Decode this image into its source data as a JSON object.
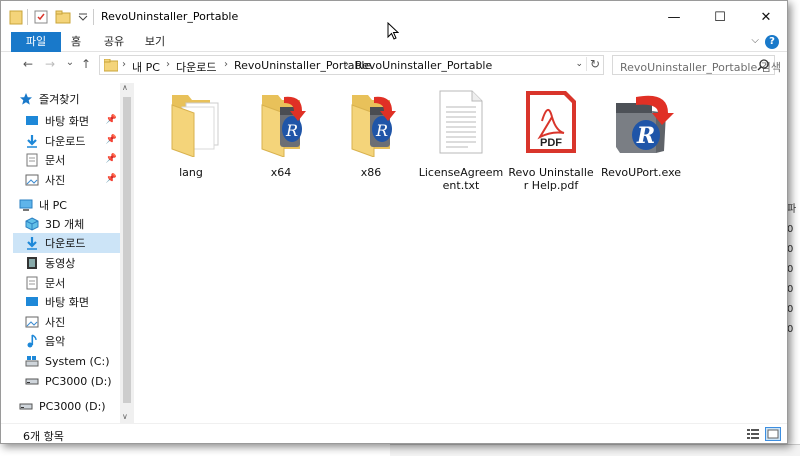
{
  "window": {
    "title": "RevoUninstaller_Portable",
    "controls": {
      "minimize": "—",
      "maximize": "☐",
      "close": "✕"
    }
  },
  "ribbon": {
    "tabs": [
      "파일",
      "홈",
      "공유",
      "보기"
    ],
    "help": "?",
    "collapse": "⌵"
  },
  "nav": {
    "back": "←",
    "forward": "→",
    "recent": "⌄",
    "up": "↑"
  },
  "address": {
    "crumbs": [
      "내 PC",
      "다운로드",
      "RevoUninstaller_Portable",
      "RevoUninstaller_Portable"
    ],
    "separator": "›",
    "dropdown": "⌄",
    "refresh": "↻"
  },
  "search": {
    "placeholder": "RevoUninstaller_Portable 검색"
  },
  "sidebar": {
    "quick_access": "즐겨찾기",
    "quick_items": [
      "바탕 화면",
      "다운로드",
      "문서",
      "사진"
    ],
    "this_pc": "내 PC",
    "pc_items": [
      "3D 개체",
      "다운로드",
      "동영상",
      "문서",
      "바탕 화면",
      "사진",
      "음악",
      "System (C:)",
      "PC3000 (D:)"
    ],
    "drive": "PC3000 (D:)",
    "pin": "📌",
    "scroll_up": "∧",
    "scroll_down": "∨"
  },
  "files": [
    {
      "name": "lang",
      "kind": "folder"
    },
    {
      "name": "x64",
      "kind": "folder-revo"
    },
    {
      "name": "x86",
      "kind": "folder-revo"
    },
    {
      "name": "LicenseAgreement.txt",
      "kind": "text"
    },
    {
      "name": "Revo Uninstaller Help.pdf",
      "kind": "pdf"
    },
    {
      "name": "RevoUPort.exe",
      "kind": "exe"
    }
  ],
  "pdf_badge": "PDF",
  "revo_letter": "R",
  "status": {
    "count": "6개 항목"
  },
  "behind_chars": [
    "파",
    "0",
    "0",
    "0",
    "0",
    "0",
    "0"
  ],
  "colors": {
    "accent": "#1979ca",
    "selected": "#cce4f7",
    "folder": "#f4d47a",
    "pdf_red": "#d9352b"
  }
}
